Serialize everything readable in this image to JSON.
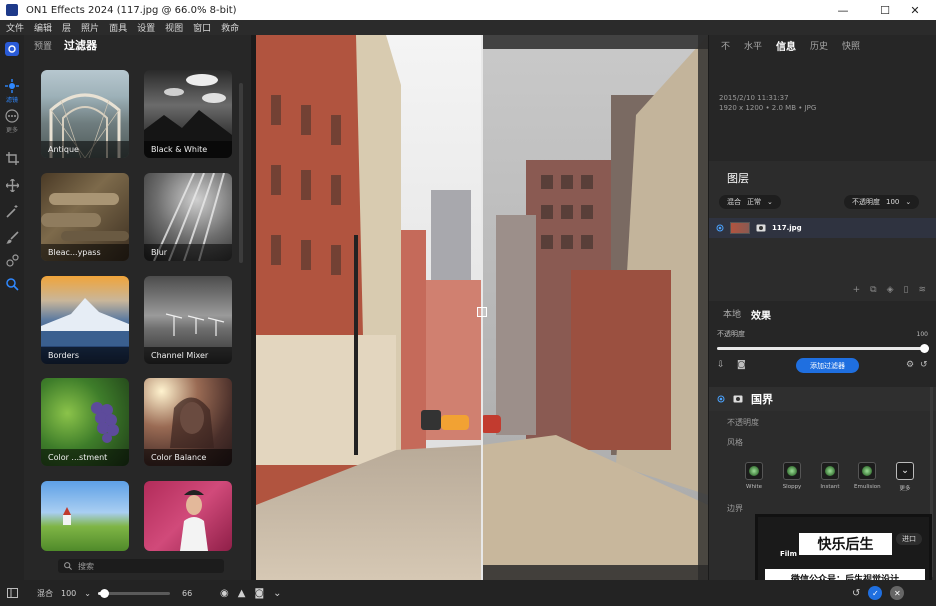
{
  "titlebar": {
    "title": "ON1 Effects 2024 (117.jpg @ 66.0% 8-bit)",
    "minimize": "—",
    "maximize": "☐",
    "close": "✕"
  },
  "menu": [
    "文件",
    "编辑",
    "层",
    "照片",
    "面具",
    "设置",
    "视图",
    "窗口",
    "救命"
  ],
  "left_tools": {
    "captions": [
      "滤镜",
      "更多"
    ]
  },
  "filter_panel": {
    "tabs": [
      "预置",
      "过滤器"
    ],
    "active_tab": "过滤器",
    "filters": [
      "Antique",
      "Black & White",
      "Bleac...ypass",
      "Blur",
      "Borders",
      "Channel Mixer",
      "Color ...stment",
      "Color Balance",
      "",
      ""
    ],
    "search_placeholder": "搜索"
  },
  "right_panel": {
    "top_tabs": [
      "不",
      "水平",
      "信息",
      "历史",
      "快照"
    ],
    "active_top_tab": "信息",
    "info": {
      "date": "2015/2/10  11:31:37",
      "details": "1920 x 1200 • 2.0 MB • JPG"
    },
    "layers_title": "图层",
    "blend_label": "混合",
    "blend_mode": "正常",
    "opacity_label": "不透明度",
    "opacity_value": "100",
    "layer_name": "117.jpg",
    "sub_tabs": [
      "本地",
      "效果"
    ],
    "active_sub_tab": "效果",
    "effect_opacity_label": "不透明度",
    "effect_opacity_value": "100",
    "effect_opacity_level": 1.0,
    "add_filter_label": "添加过滤器",
    "filter_name": "国界",
    "filter_opacity_label": "不透明度",
    "style_label": "风格",
    "styles": [
      "White",
      "Sloppy",
      "Instant",
      "Emulision",
      "更多"
    ],
    "border_label": "边界"
  },
  "watermark": {
    "title": "快乐后生",
    "subtitle": "微信公众号：后生视觉设计",
    "film_tab": "Film",
    "import_label": "进口"
  },
  "bottom_bar": {
    "blend_label": "混合",
    "blend_value": "100",
    "opacity_value": "66",
    "opacity_level": 0.09
  }
}
